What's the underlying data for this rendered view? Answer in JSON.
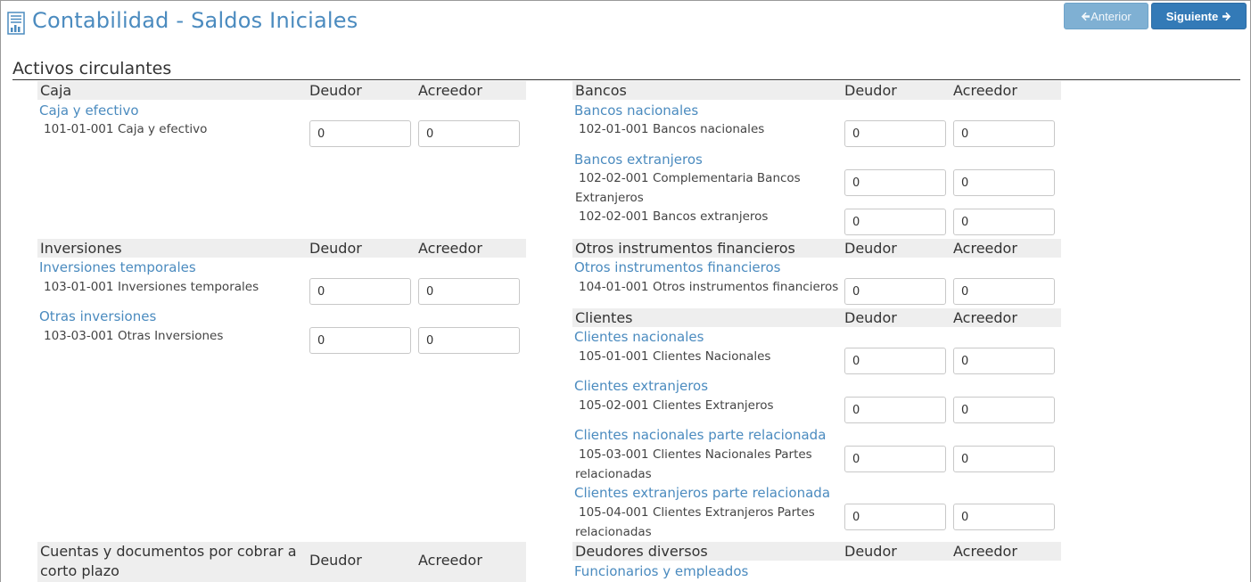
{
  "header": {
    "title": "Contabilidad - Saldos Iniciales",
    "prev_label": "Anterior",
    "next_label": "Siguiente"
  },
  "section": {
    "title": "Activos circulantes"
  },
  "columns": {
    "debit": "Deudor",
    "credit": "Acreedor"
  },
  "groups": {
    "caja": {
      "name": "Caja",
      "sub1": {
        "title": "Caja y efectivo",
        "acct1": {
          "code": "101-01-001",
          "name": "Caja y efectivo",
          "debit": "0",
          "credit": "0"
        }
      }
    },
    "bancos": {
      "name": "Bancos",
      "sub1": {
        "title": "Bancos nacionales",
        "acct1": {
          "code": "102-01-001",
          "name": "Bancos nacionales",
          "debit": "0",
          "credit": "0"
        }
      },
      "sub2": {
        "title": "Bancos extranjeros",
        "acct1": {
          "code": "102-02-001",
          "name": "Complementaria Bancos Extranjeros",
          "debit": "0",
          "credit": "0"
        },
        "acct2": {
          "code": "102-02-001",
          "name": "Bancos extranjeros",
          "debit": "0",
          "credit": "0"
        }
      }
    },
    "inversiones": {
      "name": "Inversiones",
      "sub1": {
        "title": "Inversiones temporales",
        "acct1": {
          "code": "103-01-001",
          "name": "Inversiones temporales",
          "debit": "0",
          "credit": "0"
        }
      },
      "sub2": {
        "title": "Otras inversiones",
        "acct1": {
          "code": "103-03-001",
          "name": "Otras Inversiones",
          "debit": "0",
          "credit": "0"
        }
      }
    },
    "otros": {
      "name": "Otros instrumentos financieros",
      "sub1": {
        "title": "Otros instrumentos financieros",
        "acct1": {
          "code": "104-01-001",
          "name": "Otros instrumentos financieros",
          "debit": "0",
          "credit": "0"
        }
      }
    },
    "clientes": {
      "name": "Clientes",
      "sub1": {
        "title": "Clientes nacionales",
        "acct1": {
          "code": "105-01-001",
          "name": "Clientes Nacionales",
          "debit": "0",
          "credit": "0"
        }
      },
      "sub2": {
        "title": "Clientes extranjeros",
        "acct1": {
          "code": "105-02-001",
          "name": "Clientes Extranjeros",
          "debit": "0",
          "credit": "0"
        }
      },
      "sub3": {
        "title": "Clientes nacionales parte relacionada",
        "acct1": {
          "code": "105-03-001",
          "name": "Clientes Nacionales Partes relacionadas",
          "debit": "0",
          "credit": "0"
        }
      },
      "sub4": {
        "title": "Clientes extranjeros parte relacionada",
        "acct1": {
          "code": "105-04-001",
          "name": "Clientes Extranjeros Partes relacionadas",
          "debit": "0",
          "credit": "0"
        }
      }
    },
    "cuentas": {
      "name": "Cuentas y documentos por cobrar a corto plazo"
    },
    "deudores": {
      "name": "Deudores diversos",
      "sub1": {
        "title": "Funcionarios y empleados"
      }
    }
  }
}
